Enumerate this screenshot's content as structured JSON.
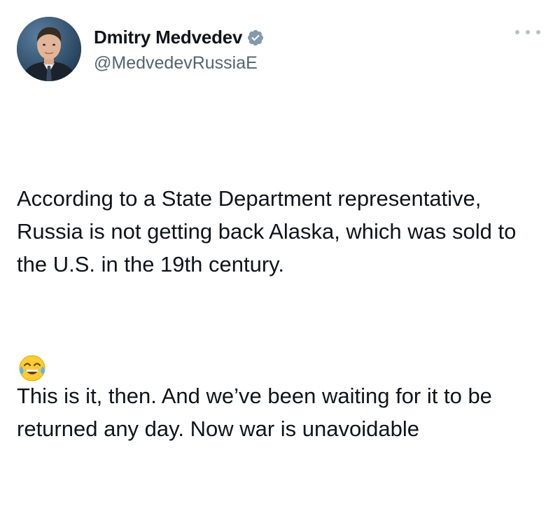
{
  "tweet": {
    "author": {
      "display_name": "Dmitry Medvedev",
      "handle": "@MedvedevRussiaE",
      "verified_icon": "verified-badge-icon",
      "avatar_icon": "profile-photo"
    },
    "more_icon": "more-options-icon",
    "paragraphs": [
      "According to a State Department representative, Russia is not getting back Alaska, which was sold to the U.S. in the 19th century.",
      "This is it, then. And we’ve been waiting for it to be returned any day. Now war is unavoidable"
    ],
    "emoji": "😂",
    "emoji_icon": "face-with-tears-of-joy-icon",
    "colors": {
      "text": "#0f1419",
      "handle": "#536471",
      "verified": "#829aab",
      "more_dots": "#b8c0c6",
      "background": "#ffffff"
    }
  }
}
